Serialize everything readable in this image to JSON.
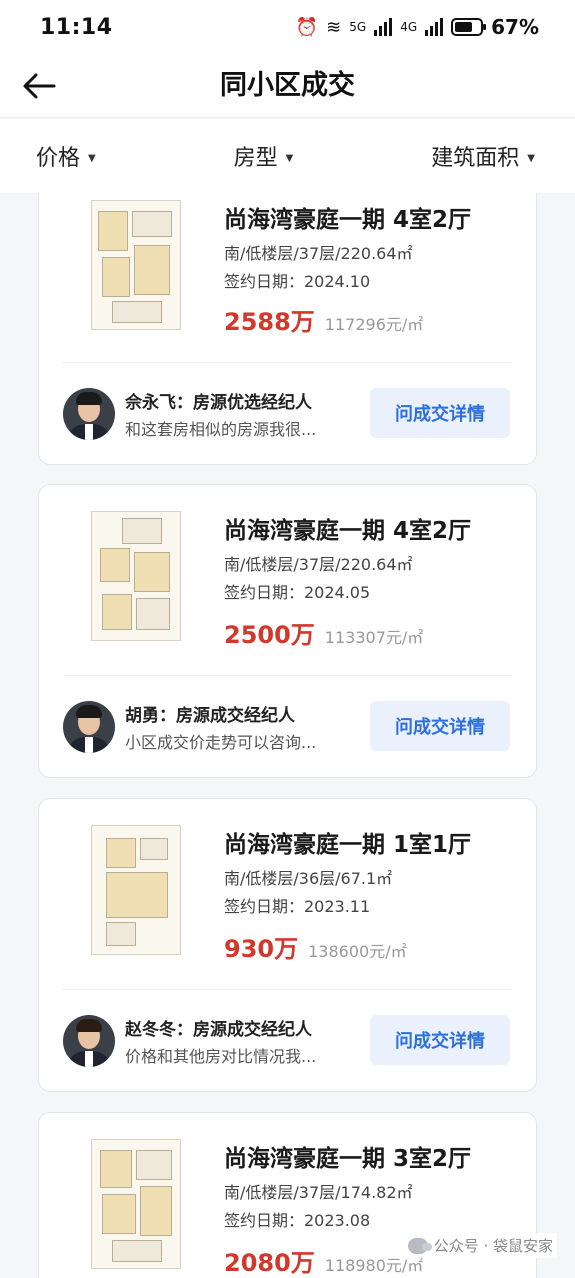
{
  "status": {
    "time": "11:14",
    "net1": "5G",
    "net2": "4G",
    "battery": "67%"
  },
  "header": {
    "title": "同小区成交",
    "back_icon": "back-arrow-icon"
  },
  "filters": [
    {
      "label": "价格"
    },
    {
      "label": "房型"
    },
    {
      "label": "建筑面积"
    }
  ],
  "listings": [
    {
      "title": "尚海湾豪庭一期 4室2厅",
      "meta": "南/低楼层/37层/220.64㎡",
      "date": "签约日期：2024.10",
      "price": "2588万",
      "unit_price": "117296元/㎡",
      "agent_name": "佘永飞：房源优选经纪人",
      "agent_desc": "和这套房相似的房源我很...",
      "button": "问成交详情"
    },
    {
      "title": "尚海湾豪庭一期 4室2厅",
      "meta": "南/低楼层/37层/220.64㎡",
      "date": "签约日期：2024.05",
      "price": "2500万",
      "unit_price": "113307元/㎡",
      "agent_name": "胡勇：房源成交经纪人",
      "agent_desc": "小区成交价走势可以咨询...",
      "button": "问成交详情"
    },
    {
      "title": "尚海湾豪庭一期 1室1厅",
      "meta": "南/低楼层/36层/67.1㎡",
      "date": "签约日期：2023.11",
      "price": "930万",
      "unit_price": "138600元/㎡",
      "agent_name": "赵冬冬：房源成交经纪人",
      "agent_desc": "价格和其他房对比情况我...",
      "button": "问成交详情"
    },
    {
      "title": "尚海湾豪庭一期 3室2厅",
      "meta": "南/低楼层/37层/174.82㎡",
      "date": "签约日期：2023.08",
      "price": "2080万",
      "unit_price": "118980元/㎡"
    }
  ],
  "watermark": "公众号 · 袋鼠安家",
  "colors": {
    "price": "#d2382c",
    "button_text": "#2d6fdc",
    "button_bg": "#eaf1fd"
  }
}
